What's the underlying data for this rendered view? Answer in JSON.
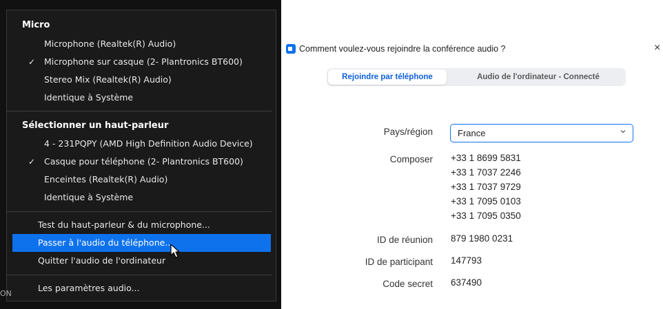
{
  "menu": {
    "micro_header": "Micro",
    "micro_items": [
      {
        "label": "Microphone (Realtek(R) Audio)",
        "checked": false
      },
      {
        "label": "Microphone sur casque (2- Plantronics BT600)",
        "checked": true
      },
      {
        "label": "Stereo Mix (Realtek(R) Audio)",
        "checked": false
      },
      {
        "label": "Identique à Système",
        "checked": false
      }
    ],
    "speaker_header": "Sélectionner un haut-parleur",
    "speaker_items": [
      {
        "label": "4 - 231PQPY (AMD High Definition Audio Device)",
        "checked": false
      },
      {
        "label": "Casque pour téléphone (2- Plantronics BT600)",
        "checked": true
      },
      {
        "label": "Enceintes (Realtek(R) Audio)",
        "checked": false
      },
      {
        "label": "Identique à Système",
        "checked": false
      }
    ],
    "actions": [
      {
        "label": "Test du haut-parleur & du microphone...",
        "active": false
      },
      {
        "label": "Passer à l'audio du téléphone...",
        "active": true
      },
      {
        "label": "Quitter l'audio de l'ordinateur",
        "active": false
      }
    ],
    "settings": "Les paramètres audio...",
    "check_glyph": "✓",
    "edge_text": "ON"
  },
  "dialog": {
    "title": "Comment voulez-vous rejoindre la conférence audio ?",
    "close_glyph": "×",
    "tabs": [
      {
        "label": "Rejoindre par téléphone",
        "selected": true
      },
      {
        "label": "Audio de l'ordinateur - Connecté",
        "selected": false
      }
    ],
    "country_label": "Pays/région",
    "country_value": "France",
    "dial_label": "Composer",
    "dial_numbers": [
      "+33 1 8699 5831",
      "+33 1 7037 2246",
      "+33 1 7037 9729",
      "+33 1 7095 0103",
      "+33 1 7095 0350"
    ],
    "meeting_id_label": "ID de réunion",
    "meeting_id": "879 1980 0231",
    "participant_id_label": "ID de participant",
    "participant_id": "147793",
    "passcode_label": "Code secret",
    "passcode": "637490"
  },
  "colors": {
    "accent": "#0e72ed",
    "menu_bg": "#1a1a1a",
    "tab_selected_text": "#0e5fd8"
  },
  "icons": {
    "check": "check-icon",
    "cursor": "mouse-pointer-icon",
    "zoom": "zoom-logo-icon",
    "chevron": "chevron-down-icon",
    "close": "close-icon"
  }
}
